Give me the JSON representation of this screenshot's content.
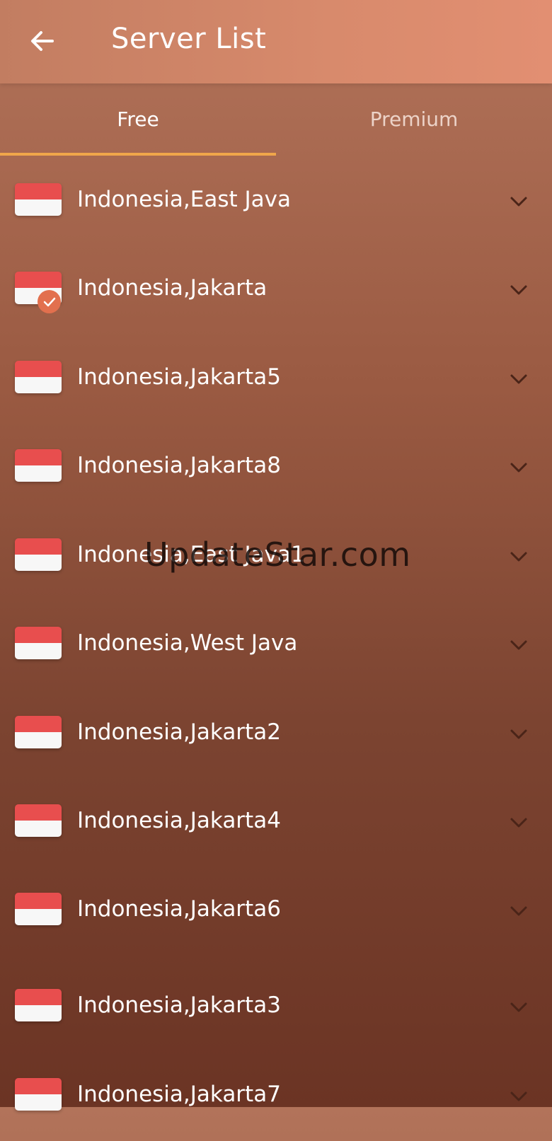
{
  "header": {
    "title": "Server List",
    "back_icon": "arrow-left-icon"
  },
  "tabs": [
    {
      "label": "Free",
      "active": true
    },
    {
      "label": "Premium",
      "active": false
    }
  ],
  "colors": {
    "tab_indicator": "#f0a64a",
    "flag_red": "#e84e4e",
    "flag_white": "#f7f7f7",
    "selected_badge": "#e2704e"
  },
  "servers": [
    {
      "name": "Indonesia,East Java",
      "selected": false
    },
    {
      "name": "Indonesia,Jakarta",
      "selected": true
    },
    {
      "name": "Indonesia,Jakarta5",
      "selected": false
    },
    {
      "name": "Indonesia,Jakarta8",
      "selected": false
    },
    {
      "name": "Indonesia,East Java1",
      "selected": false
    },
    {
      "name": "Indonesia,West Java",
      "selected": false
    },
    {
      "name": "Indonesia,Jakarta2",
      "selected": false
    },
    {
      "name": "Indonesia,Jakarta4",
      "selected": false
    },
    {
      "name": "Indonesia,Jakarta6",
      "selected": false
    },
    {
      "name": "Indonesia,Jakarta3",
      "selected": false
    },
    {
      "name": "Indonesia,Jakarta7",
      "selected": false
    }
  ],
  "watermark": "UpdateStar.com"
}
